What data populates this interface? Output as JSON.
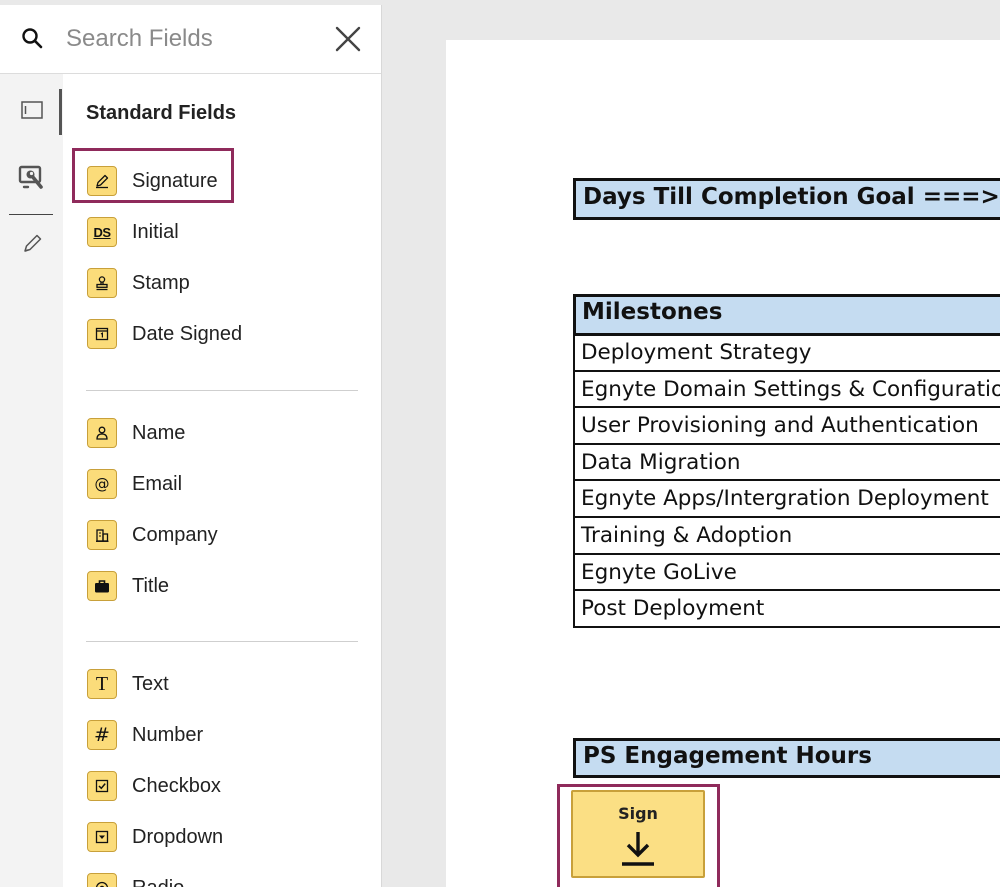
{
  "search": {
    "placeholder": "Search Fields"
  },
  "panel": {
    "section_title": "Standard Fields",
    "groups": [
      {
        "items": [
          {
            "label": "Signature",
            "icon": "pen-icon"
          },
          {
            "label": "Initial",
            "icon": "ds-icon",
            "glyph": "DS"
          },
          {
            "label": "Stamp",
            "icon": "stamp-icon"
          },
          {
            "label": "Date Signed",
            "icon": "calendar-icon"
          }
        ]
      },
      {
        "items": [
          {
            "label": "Name",
            "icon": "person-icon"
          },
          {
            "label": "Email",
            "icon": "at-icon",
            "glyph": "@"
          },
          {
            "label": "Company",
            "icon": "building-icon"
          },
          {
            "label": "Title",
            "icon": "briefcase-icon"
          }
        ]
      },
      {
        "items": [
          {
            "label": "Text",
            "icon": "text-icon",
            "glyph": "T"
          },
          {
            "label": "Number",
            "icon": "hash-icon",
            "glyph": "#"
          },
          {
            "label": "Checkbox",
            "icon": "checkbox-icon"
          },
          {
            "label": "Dropdown",
            "icon": "dropdown-icon"
          },
          {
            "label": "Radio",
            "icon": "radio-icon"
          }
        ]
      }
    ]
  },
  "rail": [
    "panel-icon",
    "wrench-screen-icon",
    "pencil-icon"
  ],
  "document": {
    "goal_label": "Days Till Completion Goal ===>",
    "milestones_header": "Milestones",
    "milestones": [
      "Deployment Strategy",
      "Egnyte Domain Settings & Configuration",
      "User Provisioning and Authentication",
      "Data Migration",
      "Egnyte Apps/Intergration Deployment",
      "Training & Adoption",
      "Egnyte GoLive",
      "Post Deployment"
    ],
    "ps_header": "PS Engagement Hours",
    "sign_field_label": "Sign"
  },
  "colors": {
    "field_badge": "#fbdc7a",
    "highlight": "#8f2a5b",
    "table_header": "#c5dcf1"
  }
}
